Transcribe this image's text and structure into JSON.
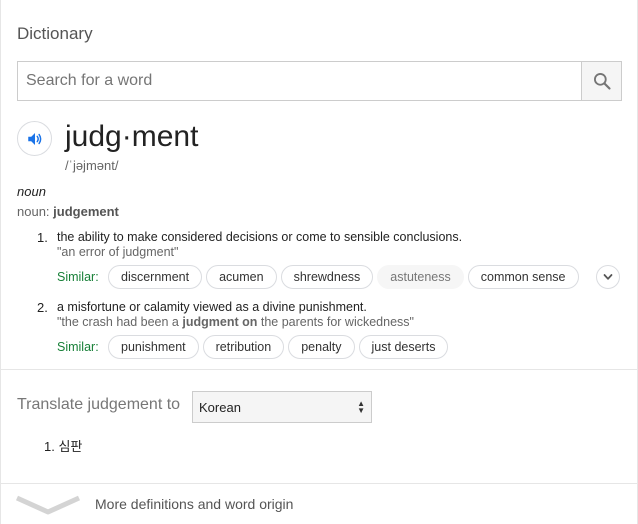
{
  "header": {
    "title": "Dictionary"
  },
  "search": {
    "placeholder": "Search for a word"
  },
  "entry": {
    "headword": "judg·ment",
    "phonetic": "/ˈjəjmənt/",
    "part_of_speech": "noun",
    "variant_prefix": "noun: ",
    "variant_word": "judgement"
  },
  "senses": [
    {
      "number": "1.",
      "definition": "the ability to make considered decisions or come to sensible conclusions.",
      "example": "\"an error of judgment\"",
      "similar_label": "Similar:",
      "similar": [
        "discernment",
        "acumen",
        "shrewdness",
        "astuteness",
        "common sense"
      ]
    },
    {
      "number": "2.",
      "definition": "a misfortune or calamity viewed as a divine punishment.",
      "example_before": "\"the crash had been a ",
      "example_bold": "judgment on",
      "example_after": " the parents for wickedness\"",
      "similar_label": "Similar:",
      "similar": [
        "punishment",
        "retribution",
        "penalty",
        "just deserts"
      ]
    }
  ],
  "translate": {
    "label": "Translate judgement to",
    "language": "Korean",
    "results": [
      {
        "number": "1.",
        "text": "심판"
      }
    ]
  },
  "footer": {
    "more_label": "More definitions and word origin"
  },
  "colors": {
    "similar_label": "#188038",
    "speaker_icon": "#1a73e8"
  }
}
